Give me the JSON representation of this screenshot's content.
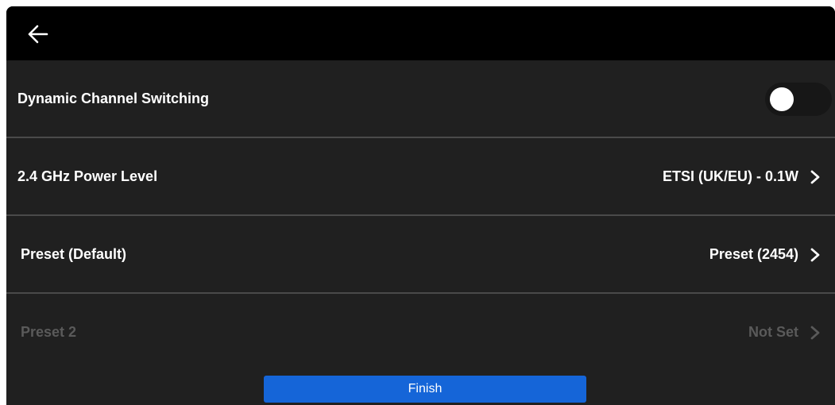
{
  "header": {
    "back_icon": "arrow-left-icon"
  },
  "settings": {
    "dynamic_channel": {
      "label": "Dynamic Channel Switching",
      "toggle_state": "off"
    },
    "power_level": {
      "label": "2.4 GHz Power Level",
      "value": "ETSI (UK/EU) - 0.1W"
    },
    "preset_default": {
      "label": "Preset (Default)",
      "value": "Preset (2454)"
    },
    "preset_2": {
      "label": "Preset 2",
      "value": "Not Set",
      "state": "disabled"
    }
  },
  "footer": {
    "finish_label": "Finish"
  },
  "colors": {
    "background": "#202020",
    "topbar": "#000000",
    "accent": "#1565d8",
    "disabled_text": "#5a5a5a"
  }
}
